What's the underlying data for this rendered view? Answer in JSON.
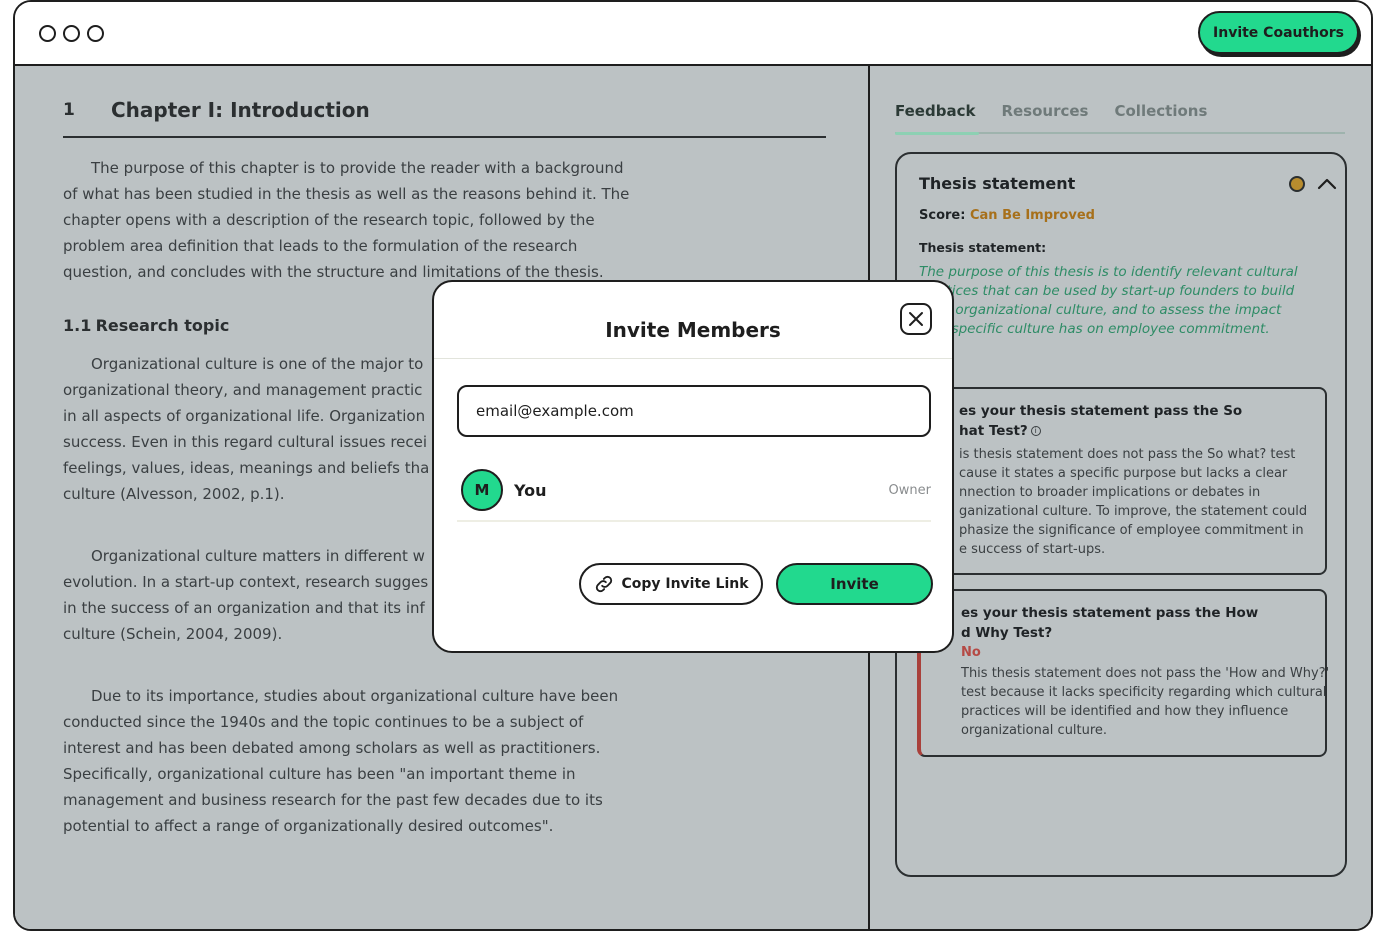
{
  "header": {
    "invite_coauthors_label": "Invite Coauthors"
  },
  "document": {
    "chapter_number": "1",
    "chapter_title": "Chapter I: Introduction",
    "intro_lines": [
      "The purpose of this chapter is to provide the reader with a background",
      "of what has been studied in the thesis as well as the reasons behind it. The",
      "chapter opens with a description of the research topic, followed by the",
      "problem area definition that leads to the formulation of the research",
      "question, and concludes with the structure and limitations of the thesis."
    ],
    "section_number": "1.1",
    "section_title": "Research topic",
    "p1_lines": [
      "Organizational culture is one of the major to",
      "organizational theory, and management practic",
      "in all aspects of organizational life. Organization",
      "success. Even in this regard cultural issues recei",
      "feelings, values, ideas, meanings and beliefs tha",
      "culture (Alvesson, 2002, p.1)."
    ],
    "p2_lines": [
      "Organizational culture matters in different w",
      "evolution. In a start-up context, research sugges",
      "in the success of an organization and that its inf",
      "culture (Schein, 2004, 2009)."
    ],
    "p3_lines": [
      "Due to its importance, studies about organizational culture have been",
      "conducted since the 1940s and the topic continues to be a subject of",
      "interest and has been debated among scholars as well as practitioners.",
      "Specifically, organizational culture has been \"an important theme in",
      "management and business research for the past few decades due to its",
      "potential to affect a range of organizationally desired outcomes\"."
    ]
  },
  "panel": {
    "tabs": [
      {
        "label": "Feedback"
      },
      {
        "label": "Resources"
      },
      {
        "label": "Collections"
      }
    ],
    "card_title": "Thesis statement",
    "score_label": "Score:",
    "score_value": "Can Be Improved",
    "status_color": "#b88c2e",
    "statement_label": "Thesis statement:",
    "statement_lines": [
      "The purpose of this thesis is to identify relevant cultural",
      "ctices that can be used by start-up founders to build",
      "le organizational culture, and to assess the impact",
      "a specific culture has on employee commitment."
    ],
    "q1": {
      "title_lines": [
        "es your thesis statement pass the So",
        "hat Test?"
      ],
      "body_lines": [
        "is thesis statement does not pass the So what? test",
        "cause it states a specific purpose but lacks a clear",
        "nnection to broader implications or debates in",
        "ganizational culture. To improve, the statement could",
        "phasize the significance of employee commitment in",
        "e success of start-ups."
      ]
    },
    "q2": {
      "title_lines": [
        "es your thesis statement pass the How",
        "d Why Test?"
      ],
      "verdict": "No",
      "body_lines": [
        "This thesis statement does not pass the 'How and Why?'",
        "test because it lacks specificity regarding which cultural",
        "practices will be identified and how they influence",
        "organizational culture."
      ]
    }
  },
  "modal": {
    "title": "Invite Members",
    "email_placeholder": "email@example.com",
    "member_initial": "M",
    "member_name": "You",
    "member_role": "Owner",
    "copy_link_label": "Copy Invite Link",
    "invite_label": "Invite",
    "accent_color": "#22d98e"
  }
}
